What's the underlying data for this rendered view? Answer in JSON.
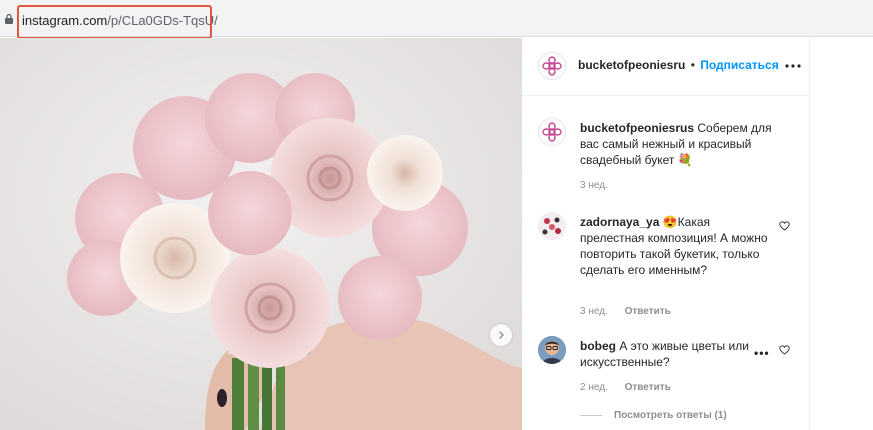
{
  "browser": {
    "url_host": "instagram.com",
    "url_path": "/p/CLa0GDs-TqsU/"
  },
  "post": {
    "author": "bucketofpeoniesru",
    "separator": "•",
    "follow_label": "Подписаться",
    "caption_user": "bucketofpeoniesrus",
    "caption_text": "Соберем для вас самый нежный и красивый свадебный букет 💐",
    "caption_time": "3 нед."
  },
  "comments": [
    {
      "user": "zadornaya_ya",
      "text": "😍Какая прелестная композиция! А можно повторить такой букетик, только сделать его именным?",
      "time": "3 нед.",
      "reply_label": "Ответить"
    },
    {
      "user": "bobeg",
      "text": "А это живые цветы или искусственные?",
      "time": "2 нед.",
      "reply_label": "Ответить",
      "view_replies": "Посмотреть ответы (1)"
    }
  ],
  "colors": {
    "accent": "#0095f6",
    "highlight_box": "#e2553f"
  },
  "icons": [
    "lock-icon",
    "chevron-right-icon",
    "more-icon",
    "heart-icon"
  ]
}
